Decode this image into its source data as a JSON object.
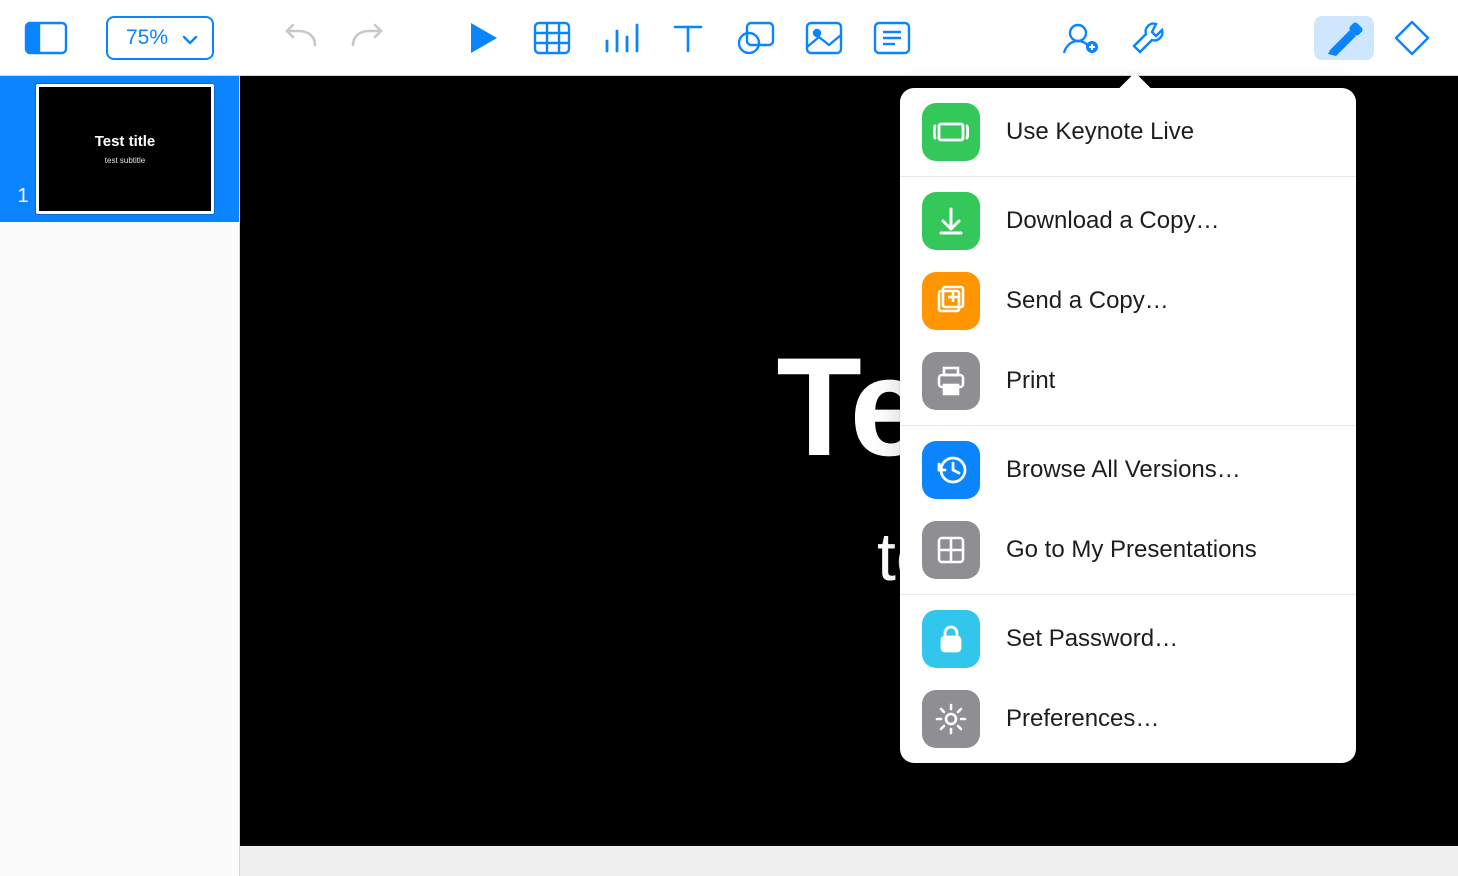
{
  "toolbar": {
    "zoom": "75%"
  },
  "sidebar": {
    "slides": [
      {
        "number": "1",
        "title": "Test title",
        "subtitle": "test subtitle"
      }
    ]
  },
  "canvas": {
    "title": "Test title",
    "subtitle": "test subtitle"
  },
  "menu": {
    "keynote_live": "Use Keynote Live",
    "download_copy": "Download a Copy…",
    "send_copy": "Send a Copy…",
    "print": "Print",
    "browse_versions": "Browse All Versions…",
    "goto_presentations": "Go to My Presentations",
    "set_password": "Set Password…",
    "preferences": "Preferences…"
  }
}
